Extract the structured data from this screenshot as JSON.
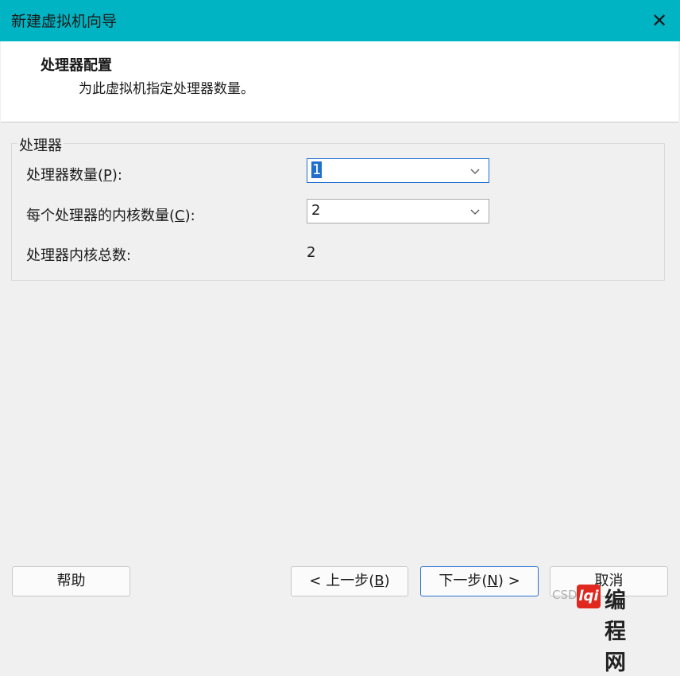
{
  "window": {
    "title": "新建虚拟机向导"
  },
  "header": {
    "title": "处理器配置",
    "subtitle": "为此虚拟机指定处理器数量。"
  },
  "group": {
    "label": "处理器"
  },
  "fields": {
    "processor_count": {
      "label_before": "处理器数量(",
      "mnemonic": "P",
      "label_after": "):",
      "value": "1"
    },
    "cores_per_processor": {
      "label_before": "每个处理器的内核数量(",
      "mnemonic": "C",
      "label_after": "):",
      "value": "2"
    },
    "total_cores": {
      "label": "处理器内核总数:",
      "value": "2"
    }
  },
  "buttons": {
    "help": "帮助",
    "back": {
      "before": "< 上一步(",
      "mnemonic": "B",
      "after": ")"
    },
    "next": {
      "before": "下一步(",
      "mnemonic": "N",
      "after": ") >"
    },
    "cancel": "取消"
  },
  "watermark": {
    "prefix": "CSD",
    "logo": "lqi",
    "site": "编程网"
  },
  "icons": {
    "close": "close-icon",
    "dropdown": "chevron-down-icon"
  },
  "colors": {
    "titlebar": "#00b4c4",
    "selection": "#1f6fd0",
    "focus_border": "#2a73d2"
  }
}
